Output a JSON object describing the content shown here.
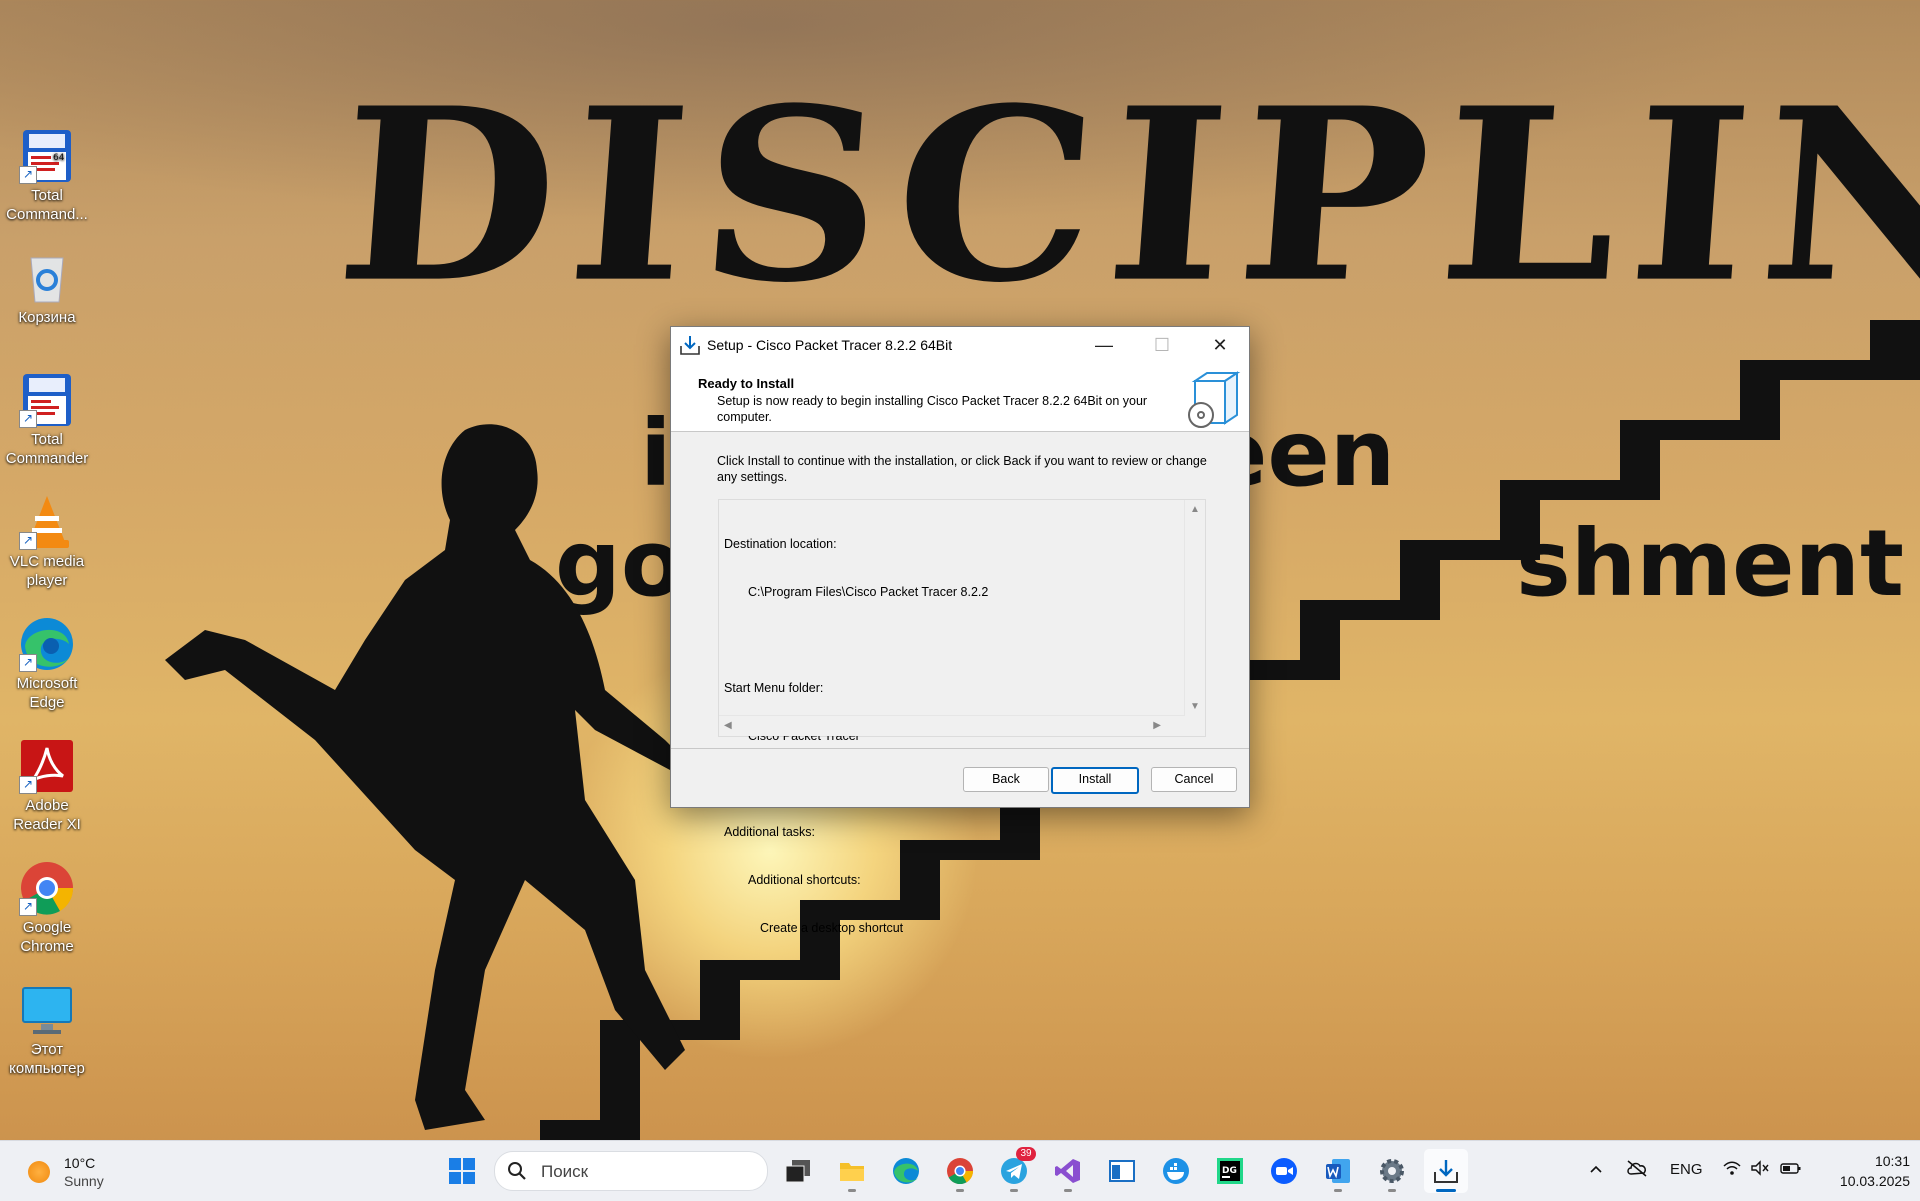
{
  "wallpaper": {
    "headline": "DISCIPLINE",
    "line2": "i              ween",
    "line3": "goo                        shment"
  },
  "desktop": {
    "icons": [
      {
        "label": "Total Command...",
        "icon": "total-commander-icon"
      },
      {
        "label": "Корзина",
        "icon": "recycle-bin-icon"
      },
      {
        "label": "Total Commander",
        "icon": "total-commander-icon"
      },
      {
        "label": "VLC media player",
        "icon": "vlc-icon"
      },
      {
        "label": "Microsoft Edge",
        "icon": "edge-icon"
      },
      {
        "label": "Adobe Reader XI",
        "icon": "adobe-reader-icon"
      },
      {
        "label": "Google Chrome",
        "icon": "chrome-icon"
      },
      {
        "label": "Этот компьютер",
        "icon": "this-pc-icon"
      }
    ]
  },
  "dialog": {
    "title": "Setup - Cisco Packet Tracer 8.2.2 64Bit",
    "header_title": "Ready to Install",
    "header_desc": "Setup is now ready to begin installing Cisco Packet Tracer 8.2.2 64Bit on your computer.",
    "body": "Click Install to continue with the installation, or click Back if you want to review or change any settings.",
    "memo": {
      "dest_label": "Destination location:",
      "dest_value": "C:\\Program Files\\Cisco Packet Tracer 8.2.2",
      "start_label": "Start Menu folder:",
      "start_value": "Cisco Packet Tracer",
      "tasks_label": "Additional tasks:",
      "shortcuts_label": "Additional shortcuts:",
      "shortcut_value": "Create a desktop shortcut"
    },
    "buttons": {
      "back": "Back",
      "install": "Install",
      "cancel": "Cancel"
    }
  },
  "taskbar": {
    "weather": {
      "temp": "10°C",
      "condition": "Sunny"
    },
    "search_placeholder": "Поиск",
    "telegram_badge": "39",
    "language": "ENG",
    "time": "10:31",
    "date": "10.03.2025"
  },
  "colors": {
    "accent": "#0067c0",
    "dialog_bg": "#f0f0f0",
    "taskbar_bg": "#eef0f4"
  }
}
